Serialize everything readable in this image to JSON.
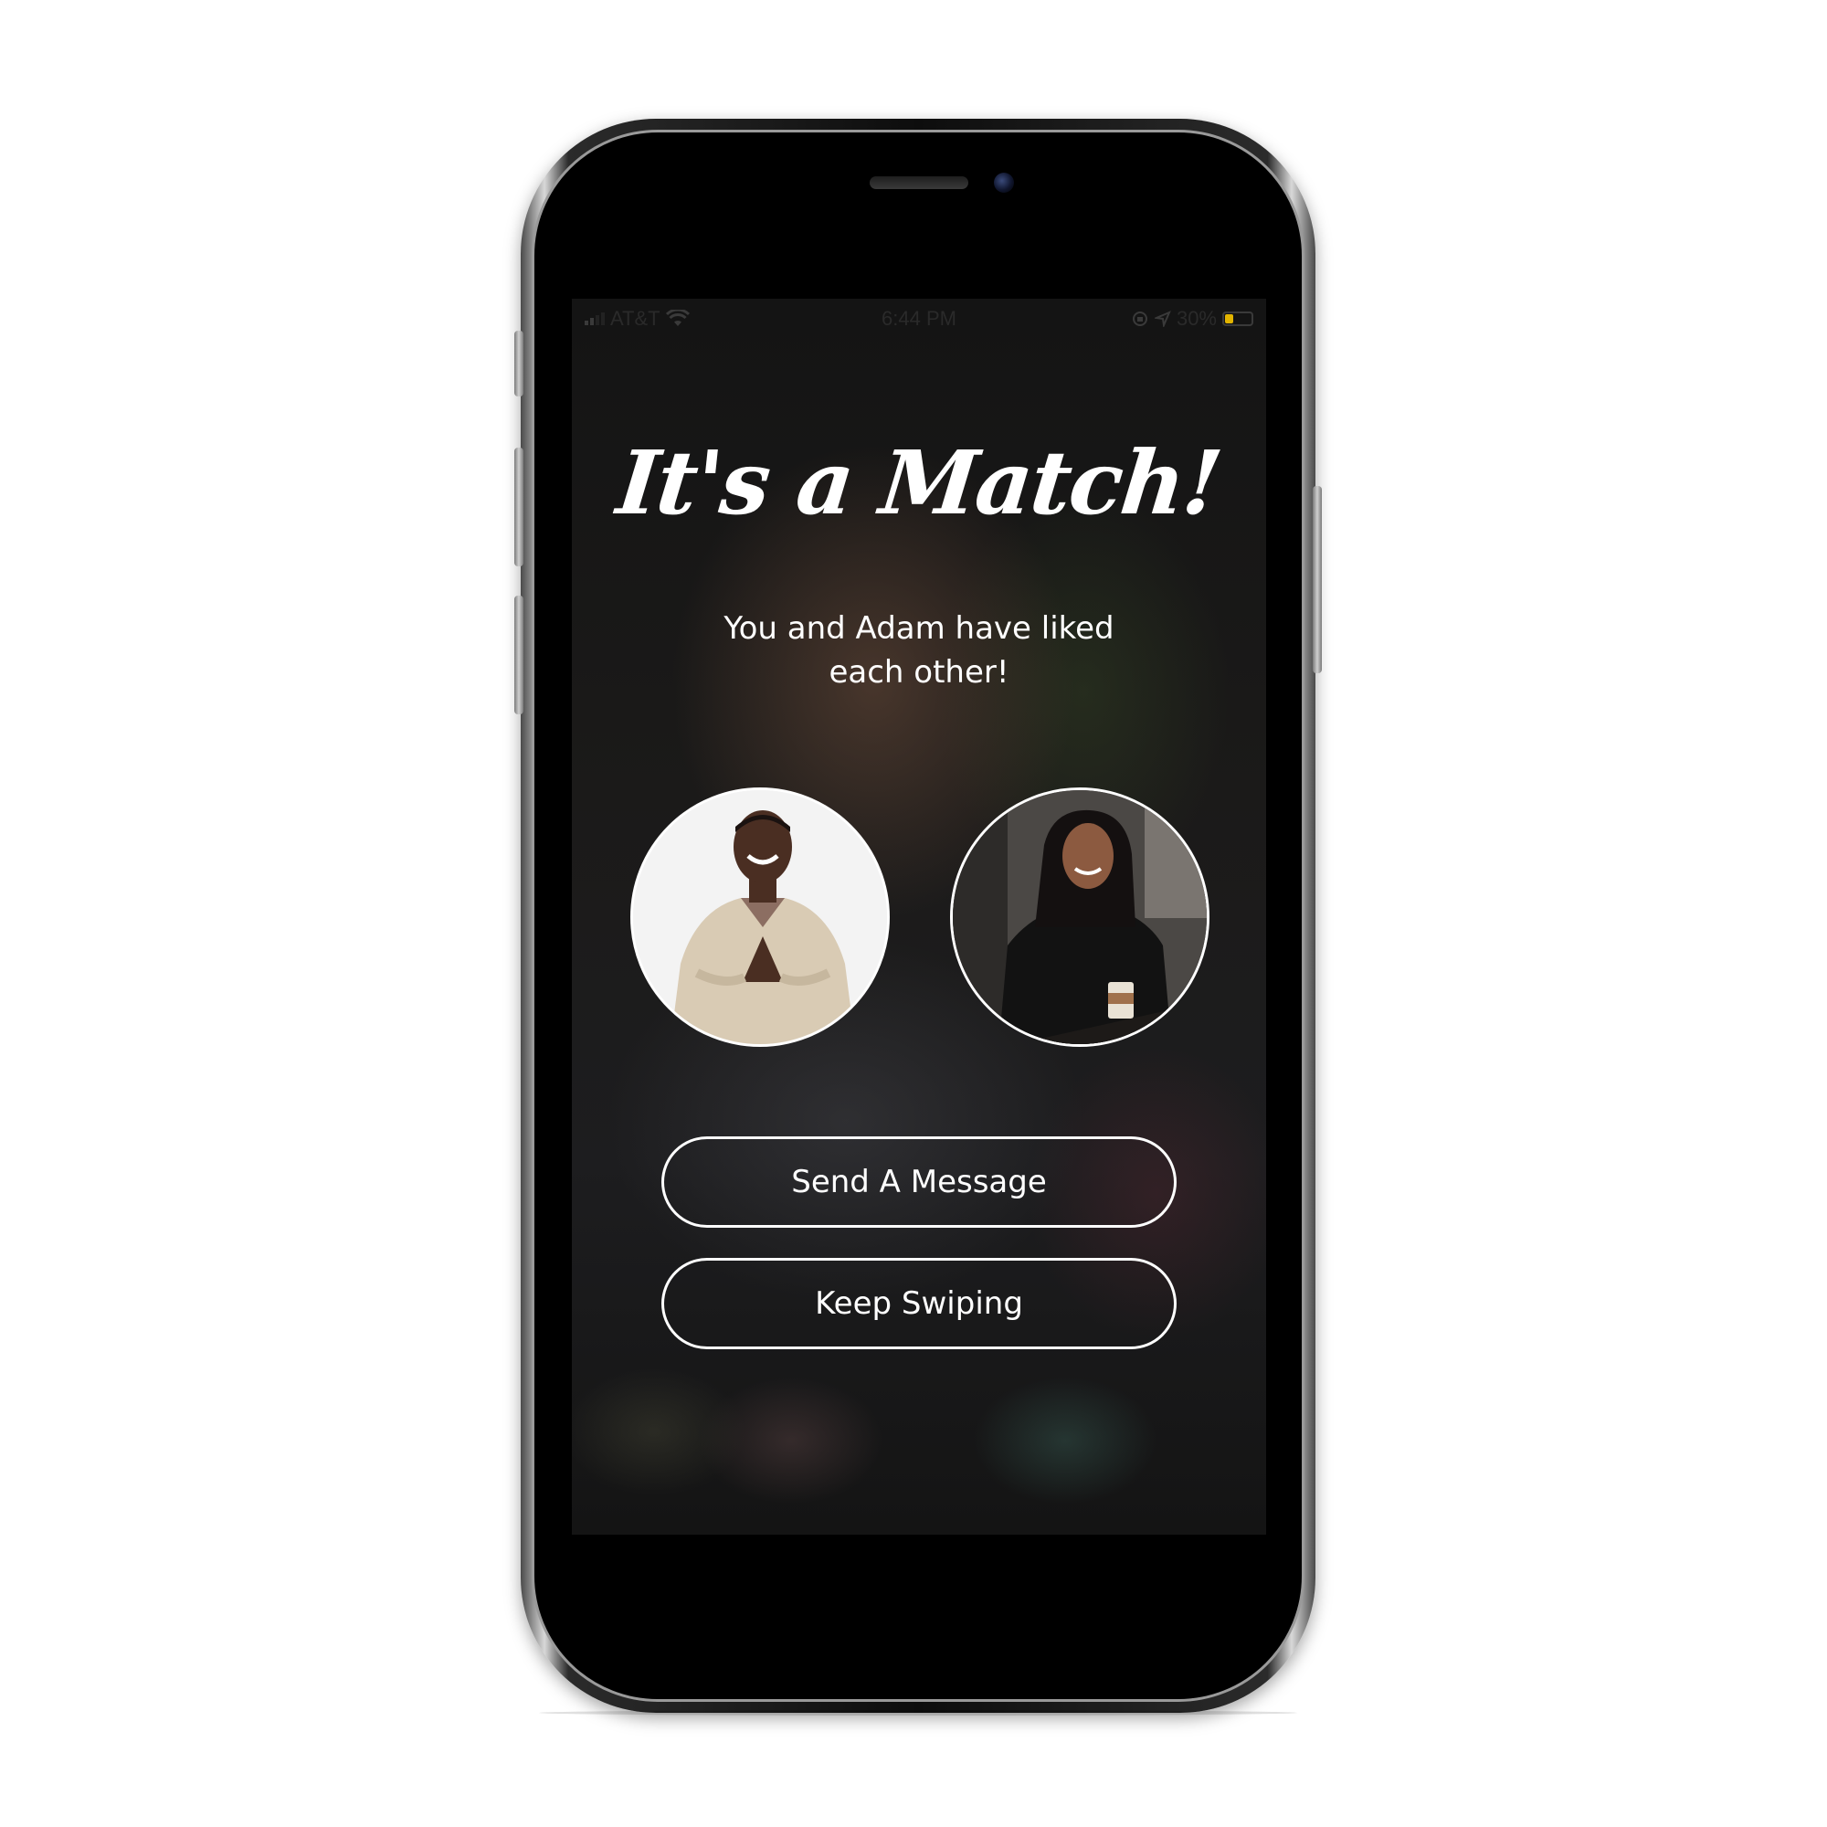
{
  "status_bar": {
    "carrier": "AT&T",
    "time": "6:44 PM",
    "battery_percent": "30%",
    "battery_level": 0.3,
    "icons": [
      "signal-icon",
      "wifi-icon",
      "orientation-lock-icon",
      "location-icon",
      "battery-icon"
    ]
  },
  "match": {
    "title": "It's a Match!",
    "subtitle": "You and Adam have liked each other!"
  },
  "avatars": {
    "left": "man-in-sweater-photo",
    "right": "woman-with-coffee-photo"
  },
  "actions": {
    "send_message_label": "Send A Message",
    "keep_swiping_label": "Keep Swiping"
  },
  "colors": {
    "text": "#ffffff",
    "background": "#161616",
    "button_border": "#ffffff",
    "battery_fill": "#e2b400"
  }
}
